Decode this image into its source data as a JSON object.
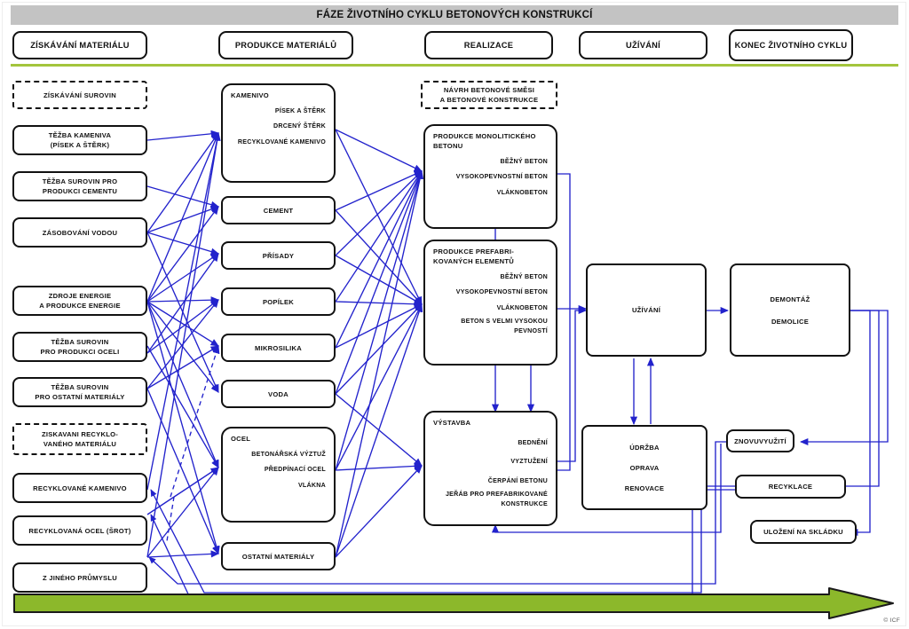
{
  "header": {
    "title": "FÁZE ŽIVOTNÍHO CYKLU BETONOVÝCH KONSTRUKCÍ",
    "bar_color": "#c3c3c3",
    "rule_color": "#a3c53c"
  },
  "phases": [
    {
      "id": "phase-ziskavani-materialu",
      "label": "ZÍSKÁVÁNÍ MATERIÁLU"
    },
    {
      "id": "phase-produkce-materialu",
      "label": "PRODUKCE MATERIÁLŮ"
    },
    {
      "id": "phase-realizace",
      "label": "REALIZACE"
    },
    {
      "id": "phase-uzivani",
      "label": "UŽÍVÁNÍ"
    },
    {
      "id": "phase-konec-zivotniho-cyklu",
      "label": "KONEC ŽIVOTNÍHO CYKLU"
    }
  ],
  "column_acquisition": {
    "group_label": "ZÍSKÁVÁNÍ SUROVIN",
    "recycled_group_label_line1": "ZISKAVANI RECYKLO-",
    "recycled_group_label_line2": "VANÉHO MATERIÁLU",
    "items": [
      {
        "id": "tezba-kameniva",
        "line1": "TĚŽBA KAMENIVA",
        "line2": "(PÍSEK A ŠTĚRK)"
      },
      {
        "id": "tezba-surovin-cement",
        "line1": "TĚŽBA SUROVIN PRO",
        "line2": "PRODUKCI CEMENTU"
      },
      {
        "id": "zasobovani-vodou",
        "line1": "ZÁSOBOVÁNÍ VODOU",
        "line2": ""
      },
      {
        "id": "zdroje-energie",
        "line1": "ZDROJE ENERGIE",
        "line2": "A PRODUKCE ENERGIE"
      },
      {
        "id": "tezba-surovin-ocel",
        "line1": "TĚŽBA SUROVIN",
        "line2": "PRO PRODUKCI OCELI"
      },
      {
        "id": "tezba-surovin-ostatni",
        "line1": "TĚŽBA SUROVIN",
        "line2": "PRO OSTATNÍ MATERIÁLY"
      },
      {
        "id": "recyklovane-kamenivo",
        "line1": "RECYKLOVANÉ KAMENIVO",
        "line2": ""
      },
      {
        "id": "recyklovana-ocel",
        "line1": "RECYKLOVANÁ OCEL (ŠROT)",
        "line2": ""
      },
      {
        "id": "z-jineho-prumyslu",
        "line1": "Z JINÉHO PRŮMYSLU",
        "line2": ""
      }
    ]
  },
  "column_materials": {
    "kamenivo": {
      "title": "KAMENIVO",
      "items": [
        "PÍSEK A ŠTĚRK",
        "DRCENÝ ŠTĚRK",
        "RECYKLOVANÉ KAMENIVO"
      ]
    },
    "simple": [
      {
        "id": "cement",
        "label": "CEMENT"
      },
      {
        "id": "prisady",
        "label": "PŘÍSADY"
      },
      {
        "id": "popilek",
        "label": "POPÍLEK"
      },
      {
        "id": "mikrosilika",
        "label": "MIKROSILIKA"
      },
      {
        "id": "voda",
        "label": "VODA"
      }
    ],
    "ocel": {
      "title": "OCEL",
      "items": [
        "BETONÁŘSKÁ VÝZTUŽ",
        "PŘEDPÍNACÍ OCEL",
        "VLÁKNA"
      ]
    },
    "ostatni": {
      "id": "ostatni-materialy",
      "label": "OSTATNÍ MATERIÁLY"
    }
  },
  "column_realization": {
    "design": {
      "line1": "NÁVRH BETONOVÉ SMĚSI",
      "line2": "A BETONOVÉ KONSTRUKCE"
    },
    "monolithic": {
      "title_line1": "PRODUKCE MONOLITICKÉHO",
      "title_line2": "BETONU",
      "items": [
        "BĚŽNÝ BETON",
        "VYSOKOPEVNOSTNÍ BETON",
        "VLÁKNOBETON"
      ]
    },
    "prefab": {
      "title_line1": "PRODUKCE PREFABRI-",
      "title_line2": "KOVANÝCH ELEMENTŮ",
      "items": [
        "BĚŽNÝ BETON",
        "VYSOKOPEVNOSTNÍ BETON",
        "VLÁKNOBETON"
      ],
      "item_long_line1": "BETON S VELMI VYSOKOU",
      "item_long_line2": "PEVNOSTÍ"
    },
    "construction": {
      "title": "VÝSTAVBA",
      "items": [
        "BEDNĚNÍ",
        "VYZTUŽENÍ",
        "ČERPÁNÍ BETONU"
      ],
      "item_long_line1": "JEŘÁB PRO PREFABRIKOVANÉ",
      "item_long_line2": "KONSTRUKCE"
    }
  },
  "column_use": {
    "use": {
      "id": "uzivani",
      "label": "UŽÍVÁNÍ"
    },
    "maintenance": {
      "id": "udrzba",
      "items": [
        "ÚDRŽBA",
        "OPRAVA",
        "RENOVACE"
      ]
    }
  },
  "column_endoflife": {
    "demolition": {
      "id": "demontaz",
      "items": [
        "DEMONTÁŽ",
        "DEMOLICE"
      ]
    },
    "reuse": {
      "id": "znovuvyuziti",
      "label": "ZNOVUVYUŽITÍ"
    },
    "recycle": {
      "id": "recyklace",
      "label": "RECYKLACE"
    },
    "landfill": {
      "id": "ulozeni-na-skladku",
      "label": "ULOŽENÍ NA SKLÁDKU"
    }
  },
  "timeline": {
    "arrow_color": "#8cb82b",
    "arrow_outline": "#1a1a1a"
  },
  "credit": "© ICF",
  "wire_color": "#2222cc"
}
